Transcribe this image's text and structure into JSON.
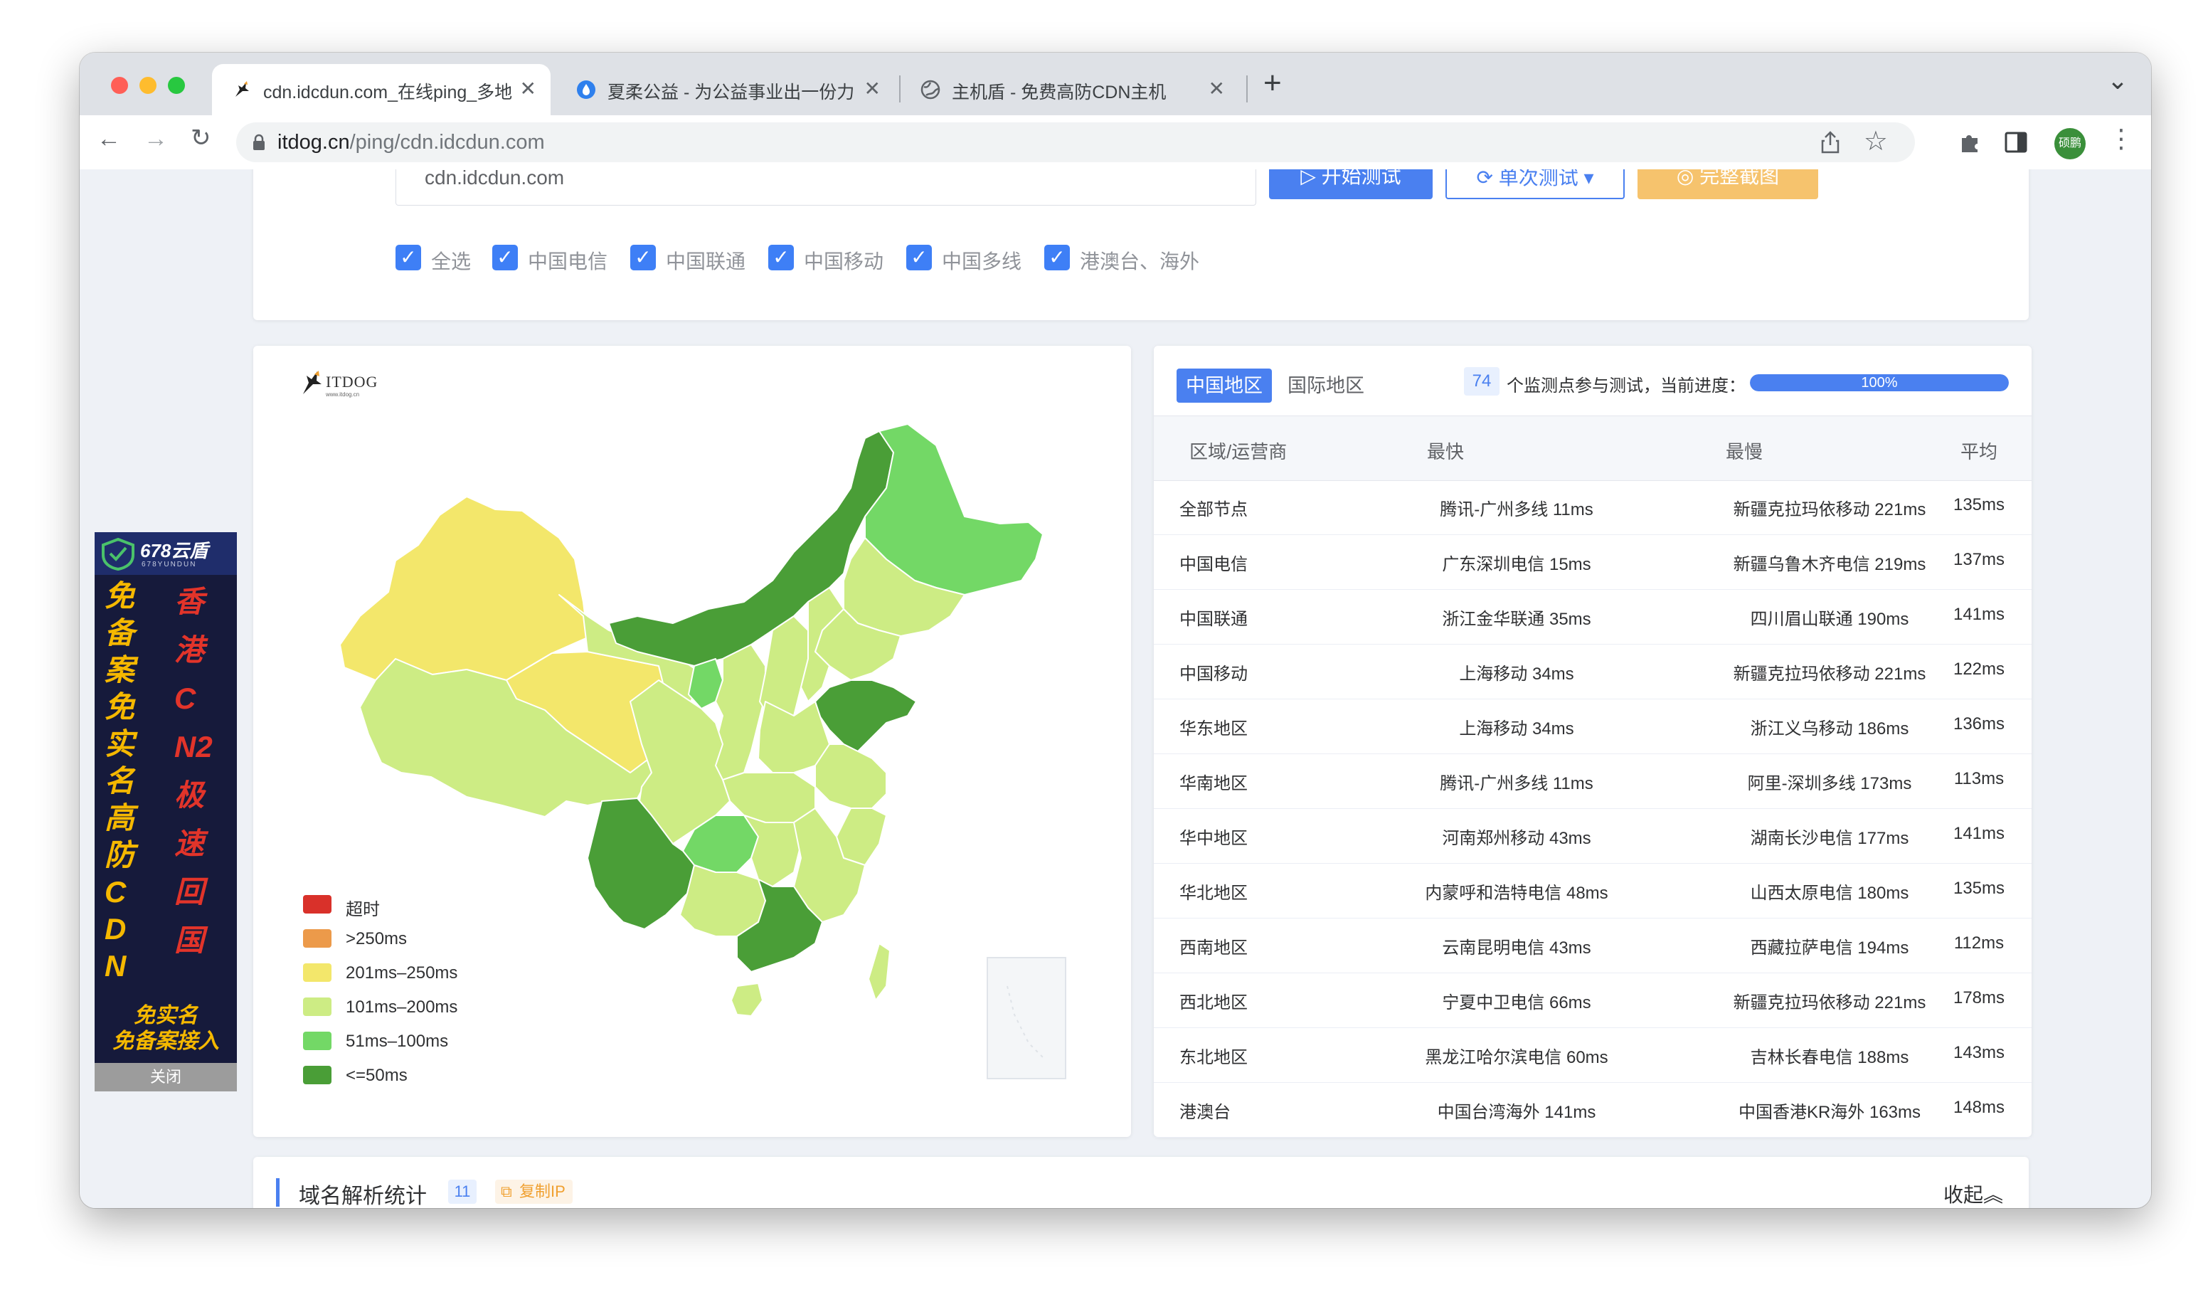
{
  "browser": {
    "tabs": [
      {
        "title": "cdn.idcdun.com_在线ping_多地",
        "close": "✕"
      },
      {
        "title": "夏柔公益 - 为公益事业出一份力",
        "close": "✕"
      },
      {
        "title": "主机盾 - 免费高防CDN主机",
        "close": "✕"
      }
    ],
    "new_tab": "+",
    "tab_menu": "⌄",
    "url_domain": "itdog.cn",
    "url_path": "/ping/cdn.idcdun.com",
    "profile_label": "硕鹏",
    "back": "←",
    "forward": "→",
    "reload": "↻"
  },
  "search": {
    "value": "cdn.idcdun.com",
    "start_button": "▷ 开始测试",
    "single_button": "⟳ 单次测试 ▾",
    "screenshot_button": "◎ 完整截图"
  },
  "filters": [
    {
      "label": "全选",
      "checked": true
    },
    {
      "label": "中国电信",
      "checked": true
    },
    {
      "label": "中国联通",
      "checked": true
    },
    {
      "label": "中国移动",
      "checked": true
    },
    {
      "label": "中国多线",
      "checked": true
    },
    {
      "label": "港澳台、海外",
      "checked": true
    }
  ],
  "ad": {
    "brand": "678云盾",
    "brand_sub": "678YUNDUN",
    "left_col": "免备案免实名高防CDN",
    "right_col": "香港CN2极速回国",
    "bottom1": "免实名",
    "bottom2": "免备案接入",
    "close_label": "关闭"
  },
  "map": {
    "logo": "ITDOG",
    "logo_sub": "www.itdog.cn",
    "legend": [
      {
        "label": "超时",
        "color": "#d9312a"
      },
      {
        "label": ">250ms",
        "color": "#ec9a4a"
      },
      {
        "label": "201ms–250ms",
        "color": "#f3e76b"
      },
      {
        "label": "101ms–200ms",
        "color": "#cdec84"
      },
      {
        "label": "51ms–100ms",
        "color": "#73d866"
      },
      {
        "label": "<=50ms",
        "color": "#4a9e37"
      }
    ]
  },
  "results": {
    "tab_cn": "中国地区",
    "tab_intl": "国际地区",
    "node_count": "74",
    "progress_text": "个监测点参与测试，当前进度：",
    "progress_value": "100%",
    "progress_fraction": 1.0,
    "columns": [
      "区域/运营商",
      "最快",
      "最慢",
      "平均"
    ],
    "rows": [
      [
        "全部节点",
        "腾讯-广州多线 11ms",
        "新疆克拉玛依移动 221ms",
        "135ms"
      ],
      [
        "中国电信",
        "广东深圳电信 15ms",
        "新疆乌鲁木齐电信 219ms",
        "137ms"
      ],
      [
        "中国联通",
        "浙江金华联通 35ms",
        "四川眉山联通 190ms",
        "141ms"
      ],
      [
        "中国移动",
        "上海移动 34ms",
        "新疆克拉玛依移动 221ms",
        "122ms"
      ],
      [
        "华东地区",
        "上海移动 34ms",
        "浙江义乌移动 186ms",
        "136ms"
      ],
      [
        "华南地区",
        "腾讯-广州多线 11ms",
        "阿里-深圳多线 173ms",
        "113ms"
      ],
      [
        "华中地区",
        "河南郑州移动 43ms",
        "湖南长沙电信 177ms",
        "141ms"
      ],
      [
        "华北地区",
        "内蒙呼和浩特电信 48ms",
        "山西太原电信 180ms",
        "135ms"
      ],
      [
        "西南地区",
        "云南昆明电信 43ms",
        "西藏拉萨电信 194ms",
        "112ms"
      ],
      [
        "西北地区",
        "宁夏中卫电信 66ms",
        "新疆克拉玛依移动 221ms",
        "178ms"
      ],
      [
        "东北地区",
        "黑龙江哈尔滨电信 60ms",
        "吉林长春电信 188ms",
        "143ms"
      ],
      [
        "港澳台",
        "中国台湾海外 141ms",
        "中国香港KR海外 163ms",
        "148ms"
      ]
    ]
  },
  "dns": {
    "title": "域名解析统计",
    "count": "11",
    "copy_ip": "复制IP",
    "collapse": "收起"
  }
}
